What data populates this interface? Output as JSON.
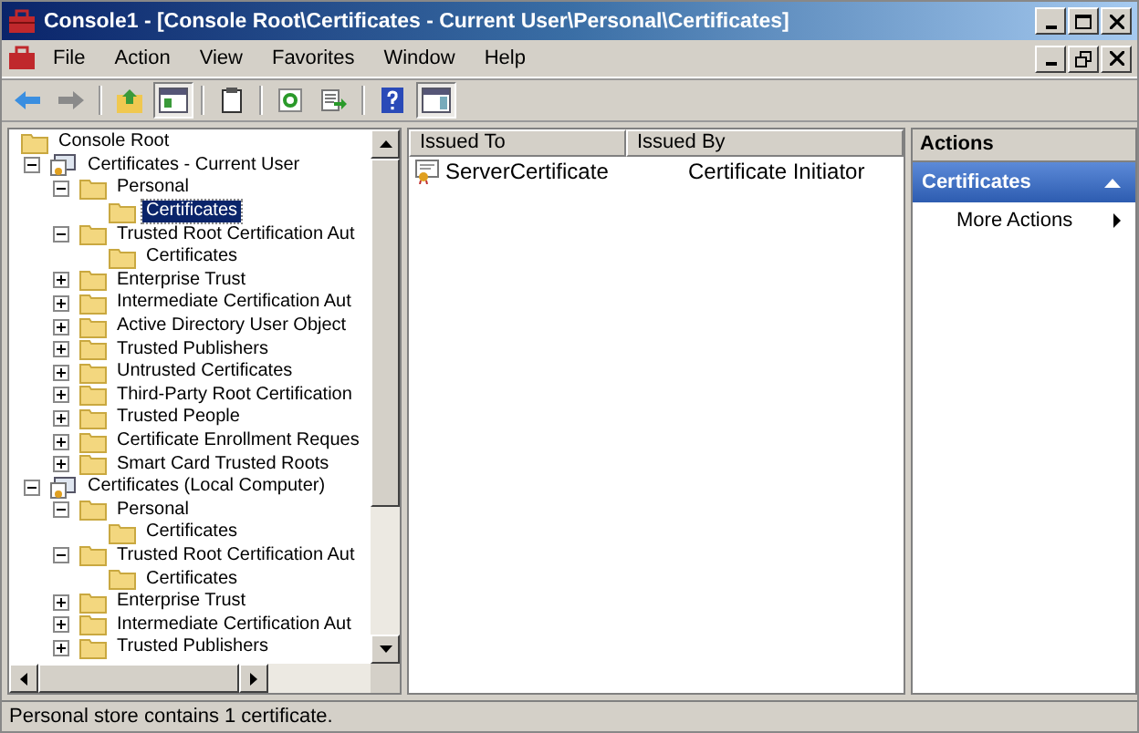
{
  "window": {
    "title": "Console1 - [Console Root\\Certificates - Current User\\Personal\\Certificates]"
  },
  "menu": [
    "File",
    "Action",
    "View",
    "Favorites",
    "Window",
    "Help"
  ],
  "toolbar": [
    {
      "kind": "back",
      "pressed": false
    },
    {
      "kind": "forward",
      "pressed": false
    },
    {
      "kind": "sep"
    },
    {
      "kind": "up",
      "pressed": false
    },
    {
      "kind": "tree",
      "pressed": true
    },
    {
      "kind": "sep"
    },
    {
      "kind": "properties",
      "pressed": false
    },
    {
      "kind": "sep"
    },
    {
      "kind": "refresh",
      "pressed": false
    },
    {
      "kind": "export",
      "pressed": false
    },
    {
      "kind": "sep"
    },
    {
      "kind": "help",
      "pressed": false
    },
    {
      "kind": "actionpane",
      "pressed": true
    }
  ],
  "tree": [
    {
      "label": "Console Root",
      "kind": "folder",
      "selected": false,
      "children": [
        {
          "label": "Certificates - Current User",
          "kind": "snapin",
          "expanded": true,
          "selected": false,
          "children": [
            {
              "label": "Personal",
              "kind": "folder",
              "expanded": true,
              "selected": false,
              "children": [
                {
                  "label": "Certificates",
                  "kind": "folder",
                  "selected": true
                }
              ]
            },
            {
              "label": "Trusted Root Certification Aut",
              "kind": "folder",
              "expanded": true,
              "selected": false,
              "children": [
                {
                  "label": "Certificates",
                  "kind": "folder",
                  "selected": false
                }
              ]
            },
            {
              "label": "Enterprise Trust",
              "kind": "folder",
              "expanded": false,
              "selected": false
            },
            {
              "label": "Intermediate Certification Aut",
              "kind": "folder",
              "expanded": false,
              "selected": false
            },
            {
              "label": "Active Directory User Object",
              "kind": "folder",
              "expanded": false,
              "selected": false
            },
            {
              "label": "Trusted Publishers",
              "kind": "folder",
              "expanded": false,
              "selected": false
            },
            {
              "label": "Untrusted Certificates",
              "kind": "folder",
              "expanded": false,
              "selected": false
            },
            {
              "label": "Third-Party Root Certification",
              "kind": "folder",
              "expanded": false,
              "selected": false
            },
            {
              "label": "Trusted People",
              "kind": "folder",
              "expanded": false,
              "selected": false
            },
            {
              "label": "Certificate Enrollment Reques",
              "kind": "folder",
              "expanded": false,
              "selected": false
            },
            {
              "label": "Smart Card Trusted Roots",
              "kind": "folder",
              "expanded": false,
              "selected": false
            }
          ]
        },
        {
          "label": "Certificates (Local Computer)",
          "kind": "snapin",
          "expanded": true,
          "selected": false,
          "children": [
            {
              "label": "Personal",
              "kind": "folder",
              "expanded": true,
              "selected": false,
              "children": [
                {
                  "label": "Certificates",
                  "kind": "folder",
                  "selected": false
                }
              ]
            },
            {
              "label": "Trusted Root Certification Aut",
              "kind": "folder",
              "expanded": true,
              "selected": false,
              "children": [
                {
                  "label": "Certificates",
                  "kind": "folder",
                  "selected": false
                }
              ]
            },
            {
              "label": "Enterprise Trust",
              "kind": "folder",
              "expanded": false,
              "selected": false
            },
            {
              "label": "Intermediate Certification Aut",
              "kind": "folder",
              "expanded": false,
              "selected": false
            },
            {
              "label": "Trusted Publishers",
              "kind": "folder",
              "expanded": false,
              "selected": false
            }
          ]
        }
      ]
    }
  ],
  "list": {
    "columns": [
      "Issued To",
      "Issued By"
    ],
    "rows": [
      {
        "cells": [
          "ServerCertificate",
          "Certificate Initiator"
        ],
        "selected": false
      }
    ]
  },
  "actions": {
    "title": "Actions",
    "section": {
      "label": "Certificates",
      "expanded": true
    },
    "items": [
      "More Actions"
    ]
  },
  "status_bar": "Personal store contains 1 certificate."
}
